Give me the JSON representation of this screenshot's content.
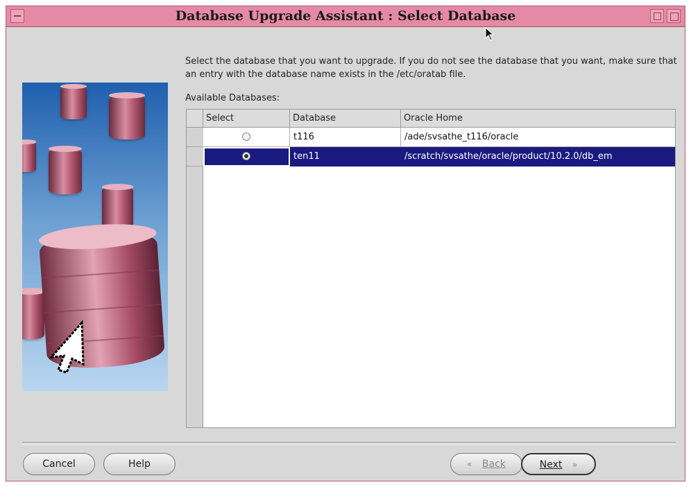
{
  "window": {
    "title": "Database Upgrade Assistant : Select Database"
  },
  "intro_text": "Select the database that you want to upgrade. If you do not see the database that you want, make sure that an entry with the database name exists in the /etc/oratab file.",
  "table": {
    "label": "Available Databases:",
    "columns": [
      "Select",
      "Database",
      "Oracle Home"
    ],
    "rows": [
      {
        "selected": false,
        "database": "t116",
        "oracle_home": "/ade/svsathe_t116/oracle"
      },
      {
        "selected": true,
        "database": "ten11",
        "oracle_home": "/scratch/svsathe/oracle/product/10.2.0/db_em"
      }
    ]
  },
  "buttons": {
    "cancel": "Cancel",
    "help": "Help",
    "back": "Back",
    "next": "Next"
  },
  "icons": {
    "back": "chevron-left-icon",
    "next": "chevron-right-icon",
    "illustration": "database-illustration"
  },
  "colors": {
    "titlebar": "#e58aa6",
    "selected_row": "#1a1a80",
    "window_bg": "#d8d8d8"
  }
}
